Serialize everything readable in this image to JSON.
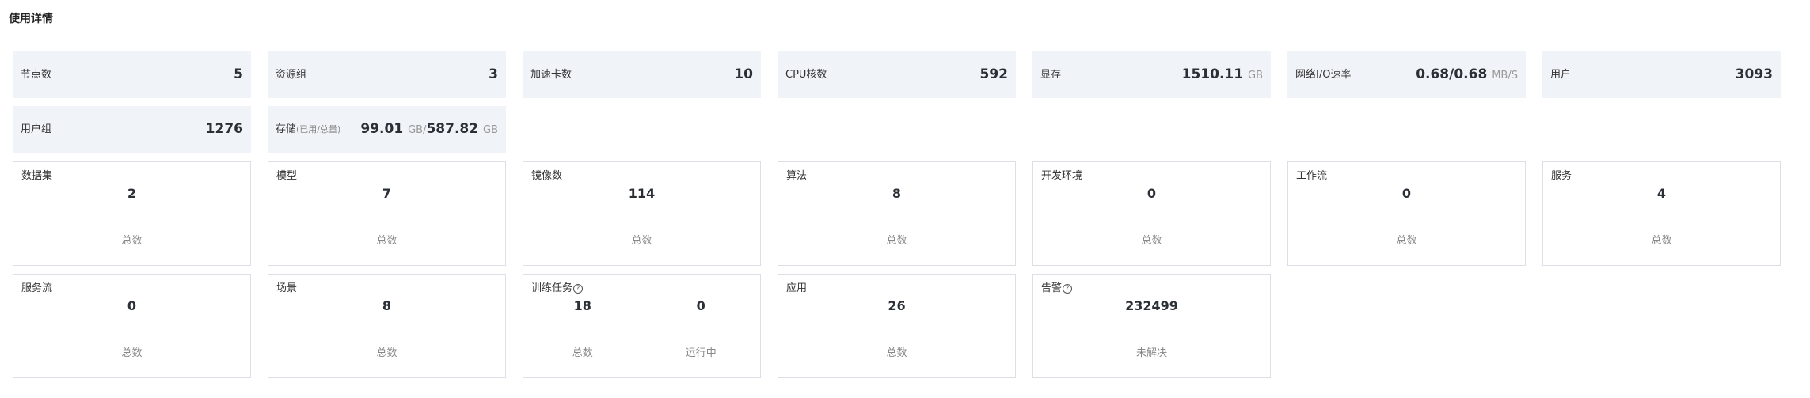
{
  "header": {
    "title": "使用详情"
  },
  "stats": [
    {
      "label": "节点数",
      "value": "5"
    },
    {
      "label": "资源组",
      "value": "3"
    },
    {
      "label": "加速卡数",
      "value": "10"
    },
    {
      "label": "CPU核数",
      "value": "592"
    },
    {
      "label": "显存",
      "value": "1510.11",
      "unit": "GB"
    },
    {
      "label": "网络I/O速率",
      "value": "0.68/0.68",
      "unit": "MB/S"
    },
    {
      "label": "用户",
      "value": "3093"
    },
    {
      "label": "用户组",
      "value": "1276"
    },
    {
      "label": "存储",
      "sublabel": "(已用/总量)",
      "used": "99.01",
      "used_unit": "GB/",
      "total": "587.82",
      "total_unit": "GB"
    }
  ],
  "cards": [
    {
      "title": "数据集",
      "value": "2",
      "caption": "总数"
    },
    {
      "title": "模型",
      "value": "7",
      "caption": "总数"
    },
    {
      "title": "镜像数",
      "value": "114",
      "caption": "总数"
    },
    {
      "title": "算法",
      "value": "8",
      "caption": "总数"
    },
    {
      "title": "开发环境",
      "value": "0",
      "caption": "总数"
    },
    {
      "title": "工作流",
      "value": "0",
      "caption": "总数"
    },
    {
      "title": "服务",
      "value": "4",
      "caption": "总数"
    },
    {
      "title": "服务流",
      "value": "0",
      "caption": "总数"
    },
    {
      "title": "场景",
      "value": "8",
      "caption": "总数"
    },
    {
      "title": "训练任务",
      "help_icon": "question-circle-icon",
      "value": "18",
      "caption": "总数",
      "value2": "0",
      "caption2": "运行中"
    },
    {
      "title": "应用",
      "value": "26",
      "caption": "总数"
    },
    {
      "title": "告警",
      "help_icon": "question-circle-icon",
      "value": "232499",
      "caption": "未解决"
    }
  ]
}
